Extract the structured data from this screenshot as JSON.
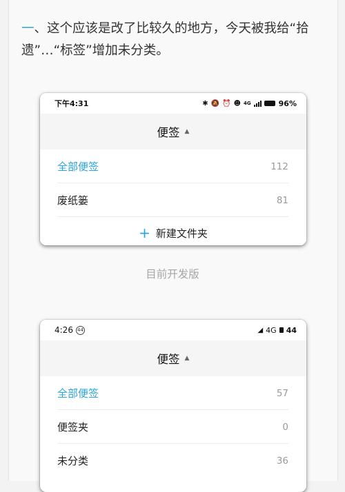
{
  "caption": {
    "accent": "一",
    "text": "、这个应该是改了比较久的地方，今天被我给“拾遗”…“标签”增加未分类。"
  },
  "phone1": {
    "statusbar": {
      "time": "下午4:31",
      "network": "4G",
      "battery": "96%"
    },
    "header": {
      "title": "便签"
    },
    "rows": [
      {
        "name": "全部便签",
        "count": "112"
      },
      {
        "name": "废纸篓",
        "count": "81"
      }
    ],
    "new_folder": "新建文件夹"
  },
  "subcaption": "目前开发版",
  "phone2": {
    "statusbar": {
      "time": "4:26",
      "badge": "44",
      "network": "4G",
      "battery": "44"
    },
    "header": {
      "title": "便签"
    },
    "rows": [
      {
        "name": "全部便签",
        "count": "57"
      },
      {
        "name": "便签夹",
        "count": "0"
      },
      {
        "name": "未分类",
        "count": "36"
      }
    ]
  },
  "colors": {
    "accent": "#2aa5d8",
    "count": "#9a9a9a",
    "header_bg": "#f5f5f5"
  }
}
